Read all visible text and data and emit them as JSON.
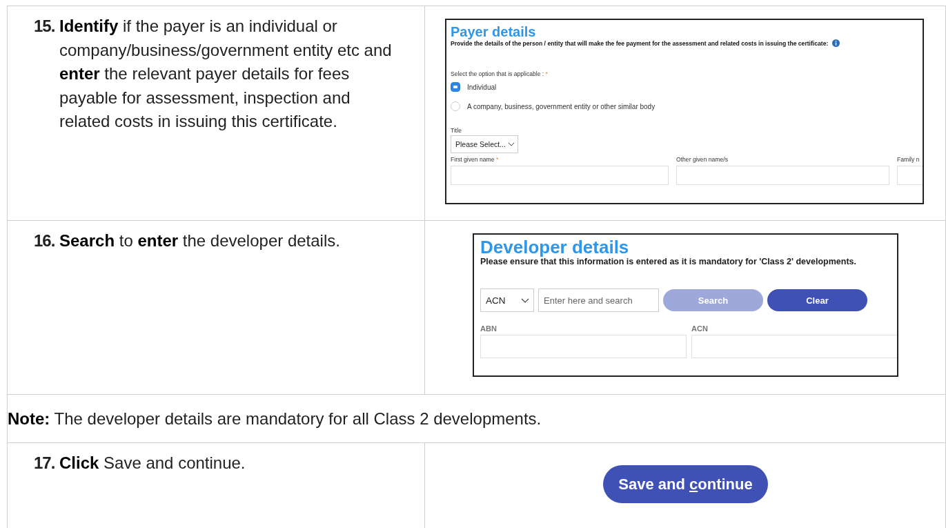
{
  "steps": [
    {
      "number": "15.",
      "text": "**Identify** if the payer is an individual or company/business/government entity etc and **enter** the relevant payer details for fees payable for assessment, inspection and related costs in issuing this certificate.",
      "kind": "payer"
    },
    {
      "number": "16.",
      "text": "**Search** to **enter** the developer details.",
      "kind": "developer"
    },
    {
      "note_label": "Note:",
      "note_text": "The developer details are mandatory for all Class 2 developments.",
      "kind": "note"
    },
    {
      "number": "17.",
      "text": "**Click** Save and continue.",
      "kind": "save"
    }
  ],
  "payer": {
    "title": "Payer details",
    "intro": "Provide the details of the person / entity that will make the fee payment for the assessment and related costs in issuing the certificate:",
    "option_label": "Select the option that is applicable :",
    "option_required_mark": "*",
    "options": [
      {
        "label": "Individual",
        "selected": true
      },
      {
        "label": "A company, business, government entity or other similar body",
        "selected": false
      }
    ],
    "title_label": "Title",
    "title_value": "Please Select...",
    "fields": [
      {
        "label": "First given name",
        "required_mark": "*"
      },
      {
        "label": "Other given name/s"
      },
      {
        "label": "Family n"
      }
    ]
  },
  "developer": {
    "title": "Developer details",
    "intro": "Please ensure that this information is entered as it is mandatory for 'Class 2' developments.",
    "type_value": "ACN",
    "search_placeholder": "Enter here and search",
    "buttons": [
      {
        "label": "Search",
        "disabled": true
      },
      {
        "label": "Clear",
        "disabled": false
      }
    ],
    "fields": [
      {
        "label": "ABN"
      },
      {
        "label": "ACN"
      }
    ]
  },
  "save_button": {
    "before": "Save and ",
    "access_key": "c",
    "after": "ontinue"
  }
}
